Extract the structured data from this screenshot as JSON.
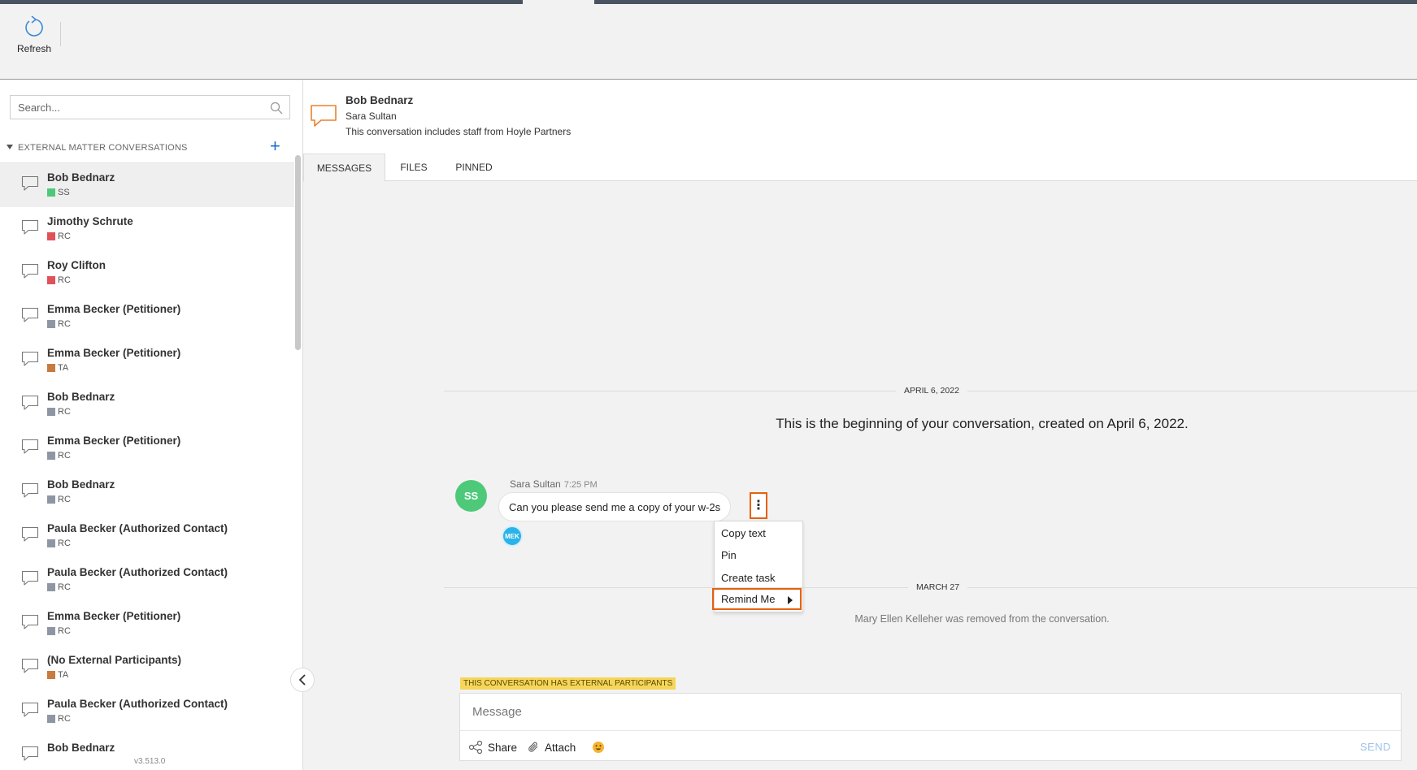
{
  "toolbar": {
    "refresh_label": "Refresh"
  },
  "sidebar": {
    "search_placeholder": "Search...",
    "section_title": "EXTERNAL MATTER CONVERSATIONS",
    "add_label": "+",
    "version": "v3.513.0",
    "items": [
      {
        "name": "Bob Bednarz",
        "tag": "SS",
        "color": "#4ec97a"
      },
      {
        "name": "Jimothy Schrute",
        "tag": "RC",
        "color": "#e0525a"
      },
      {
        "name": "Roy Clifton",
        "tag": "RC",
        "color": "#e0525a"
      },
      {
        "name": "Emma Becker (Petitioner)",
        "tag": "RC",
        "color": "#8f96a3"
      },
      {
        "name": "Emma Becker (Petitioner)",
        "tag": "TA",
        "color": "#c97a3e"
      },
      {
        "name": "Bob Bednarz",
        "tag": "RC",
        "color": "#8f96a3"
      },
      {
        "name": "Emma Becker (Petitioner)",
        "tag": "RC",
        "color": "#8f96a3"
      },
      {
        "name": "Bob Bednarz",
        "tag": "RC",
        "color": "#8f96a3"
      },
      {
        "name": "Paula Becker (Authorized Contact)",
        "tag": "RC",
        "color": "#8f96a3"
      },
      {
        "name": "Paula Becker (Authorized Contact)",
        "tag": "RC",
        "color": "#8f96a3"
      },
      {
        "name": "Emma Becker (Petitioner)",
        "tag": "RC",
        "color": "#8f96a3"
      },
      {
        "name": "(No External Participants)",
        "tag": "TA",
        "color": "#c97a3e"
      },
      {
        "name": "Paula Becker (Authorized Contact)",
        "tag": "RC",
        "color": "#8f96a3"
      },
      {
        "name": "Bob Bednarz",
        "tag": "",
        "color": ""
      }
    ]
  },
  "conversation": {
    "title": "Bob Bednarz",
    "participant": "Sara Sultan",
    "note": "This conversation includes staff from Hoyle Partners",
    "tabs": [
      "MESSAGES",
      "FILES",
      "PINNED"
    ],
    "date1": "APRIL 6, 2022",
    "beginning": "This is the beginning of your conversation, created on April 6, 2022.",
    "message": {
      "avatar": "SS",
      "sender": "Sara Sultan",
      "time": "7:25 PM",
      "text": "Can you please send me a copy of your w-2s",
      "reaction_avatar": "MEK"
    },
    "menu": [
      "Copy text",
      "Pin",
      "Create task",
      "Remind Me"
    ],
    "date2": "MARCH 27",
    "removed": "Mary Ellen Kelleher was removed from the conversation.",
    "external_banner": "THIS CONVERSATION HAS EXTERNAL PARTICIPANTS"
  },
  "composer": {
    "placeholder": "Message",
    "share": "Share",
    "attach": "Attach",
    "send": "SEND"
  }
}
